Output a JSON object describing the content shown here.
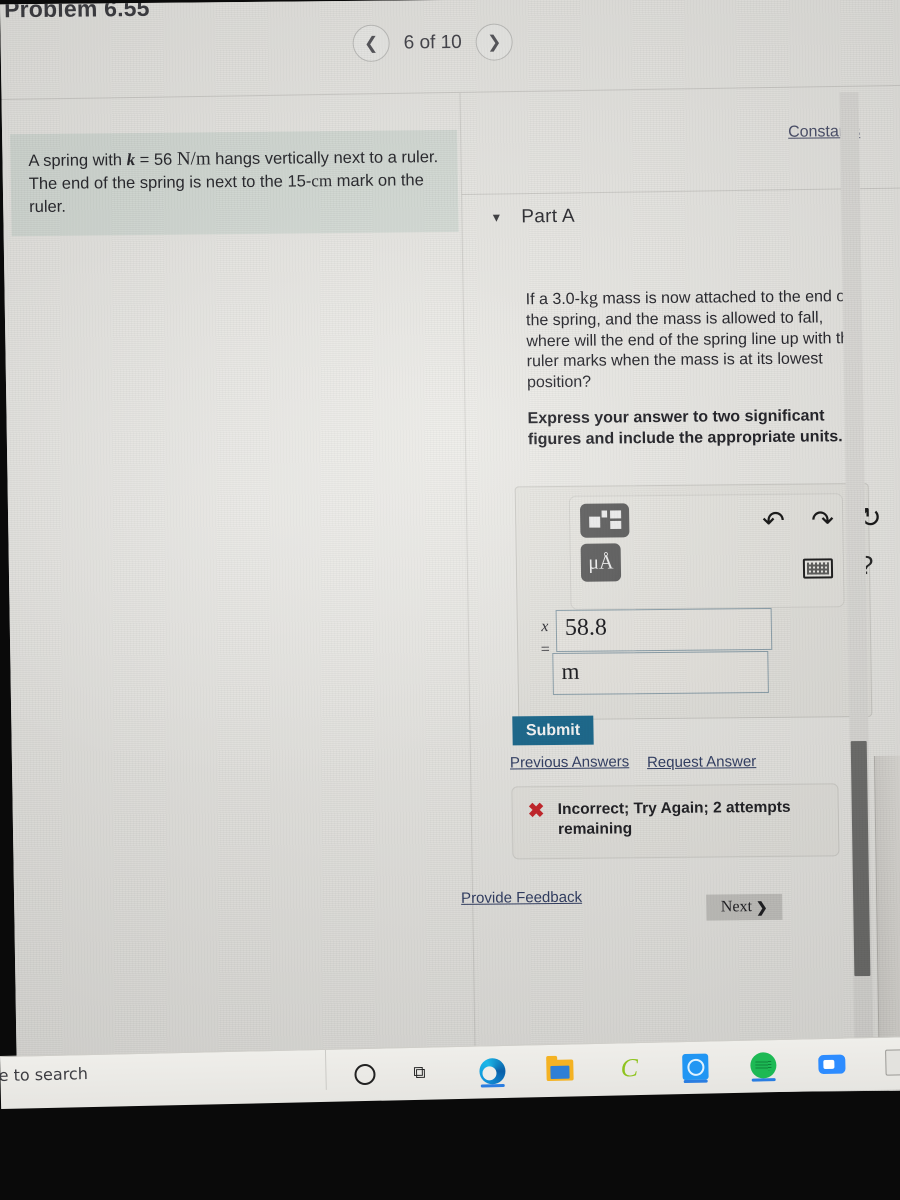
{
  "window": {
    "problem_title": "Problem 6.55"
  },
  "pager": {
    "prev_icon": "chevron-left-icon",
    "label": "6 of 10",
    "next_icon": "chevron-right-icon"
  },
  "problem_statement": {
    "text_part1": "A spring with ",
    "variable": "k",
    "equals": " = 56 ",
    "unit": "N/m",
    "text_part2": " hangs vertically next to a ruler. The end of the spring is next to the 15-",
    "unit2": "cm",
    "text_part3": " mark on the ruler."
  },
  "right_panel": {
    "constants_link": "Constants",
    "part_label": "Part A",
    "caret_icon": "caret-down-icon",
    "question_part1": "If a 3.0-",
    "question_unit": "kg",
    "question_part2": " mass is now attached to the end of the spring, and the mass is allowed to fall, where will the end of the spring line up with the ruler marks when the mass is at its lowest position?",
    "instruction": "Express your answer to two significant figures and include the appropriate units."
  },
  "answer_widget": {
    "template_button_icon": "math-template-icon",
    "units_button_label": "μÅ",
    "undo_icon": "undo-arrow-icon",
    "redo_icon": "redo-arrow-icon",
    "reset_icon": "reset-circular-arrow-icon",
    "keyboard_icon": "keyboard-icon",
    "help_label": "?",
    "variable_label": "x",
    "equals_label": "=",
    "value": "58.8",
    "units_value": "m"
  },
  "actions": {
    "submit_label": "Submit",
    "previous_answers_label": "Previous Answers",
    "request_answer_label": "Request Answer",
    "provide_feedback_label": "Provide Feedback",
    "next_label": "Next",
    "next_chevron": "❯"
  },
  "result": {
    "icon": "red-x-icon",
    "message": "Incorrect; Try Again; 2 attempts remaining",
    "accent_color": "#cc2127"
  },
  "scroll": {
    "down_arrow": "▼"
  },
  "taskbar": {
    "search_placeholder": "re to search",
    "items": [
      {
        "name": "cortana-icon"
      },
      {
        "name": "task-view-icon",
        "glyph": "⧉"
      },
      {
        "name": "edge-browser-icon"
      },
      {
        "name": "file-explorer-icon"
      },
      {
        "name": "chegg-icon",
        "glyph": "C"
      },
      {
        "name": "blue-app-icon"
      },
      {
        "name": "spotify-icon"
      },
      {
        "name": "zoom-icon"
      },
      {
        "name": "calculator-icon"
      }
    ]
  },
  "colors": {
    "submit_blue": "#17698f",
    "statement_bg": "#d9e0da",
    "link": "#2f3c64"
  }
}
